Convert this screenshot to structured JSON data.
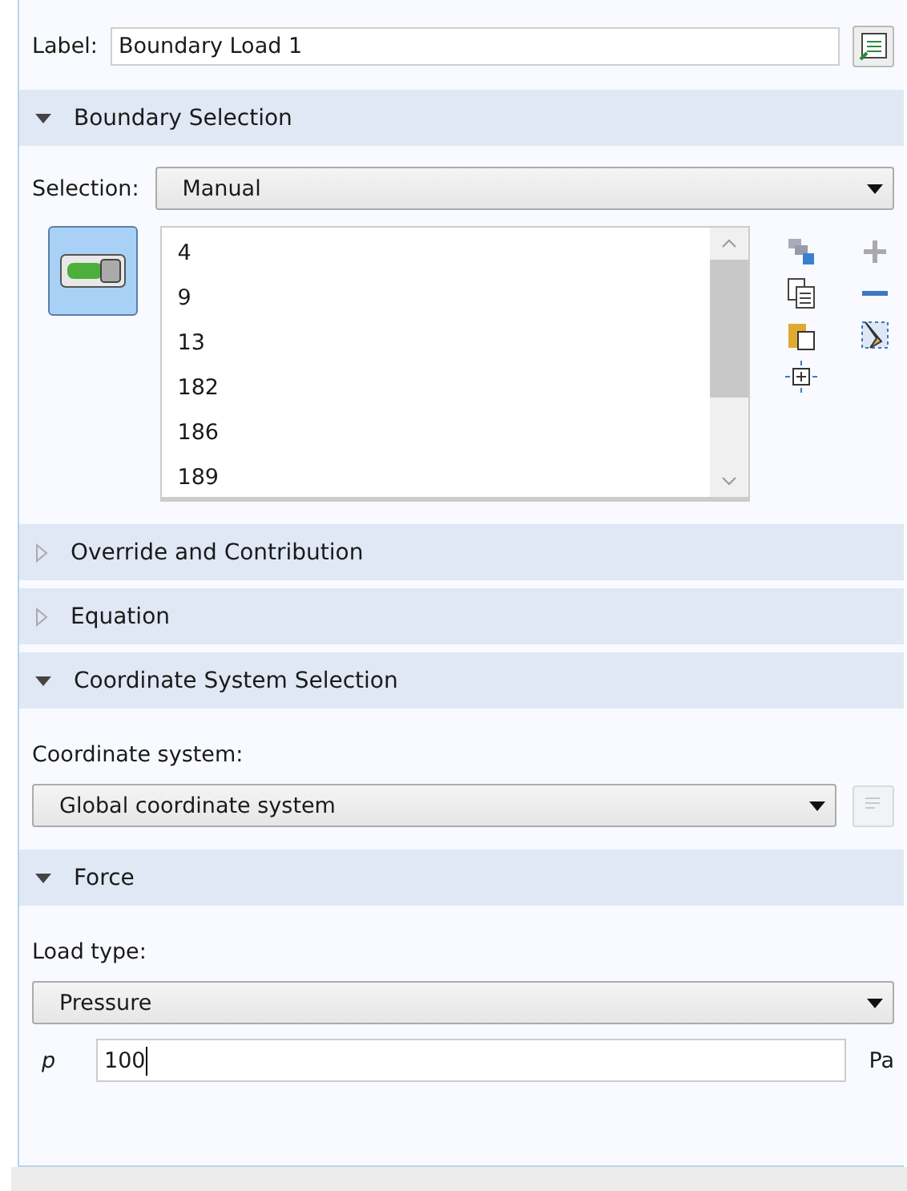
{
  "label_field": {
    "label": "Label:",
    "value": "Boundary Load 1"
  },
  "sections": [
    {
      "title": "Boundary Selection",
      "expanded": true,
      "kind": "selection",
      "selection_label": "Selection:",
      "selection_value": "Manual",
      "active_toggle": true,
      "entities": [
        "4",
        "9",
        "13",
        "182",
        "186",
        "189"
      ]
    },
    {
      "title": "Override and Contribution",
      "expanded": false
    },
    {
      "title": "Equation",
      "expanded": false
    },
    {
      "title": "Coordinate System Selection",
      "expanded": true,
      "kind": "coordinate",
      "field_label": "Coordinate system:",
      "value": "Global coordinate system"
    },
    {
      "title": "Force",
      "expanded": true,
      "kind": "force",
      "field_label": "Load type:",
      "value": "Pressure",
      "symbol": "p",
      "input_value": "100",
      "unit": "Pa"
    }
  ]
}
